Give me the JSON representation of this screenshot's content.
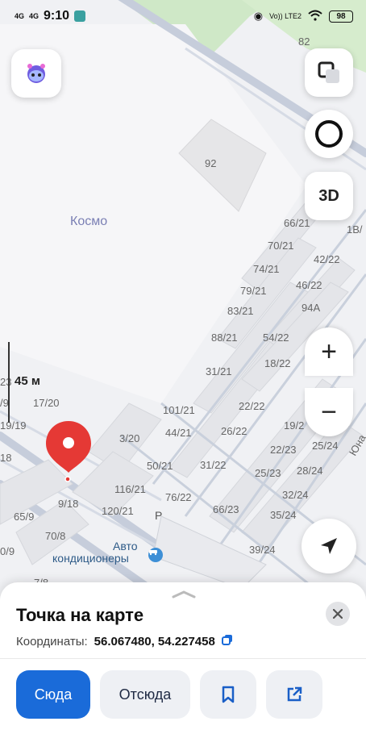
{
  "status_bar": {
    "signal1": "4G",
    "signal2": "4G",
    "time": "9:10",
    "volte": "Vo)) LTE2",
    "battery": "98"
  },
  "map": {
    "place_name": "Космо",
    "scale_label": "45 м",
    "poi_name_line1": "Авто",
    "poi_name_line2": "кондиционеры",
    "street_label": "Юна",
    "parking_label": "P",
    "house_numbers": [
      "82",
      "92",
      "1В/",
      "66/21",
      "70/21",
      "42/22",
      "74/21",
      "46/22",
      "79/21",
      "94А",
      "83/21",
      "88/21",
      "54/22",
      "18/22",
      "31/21",
      "22/22",
      "101/21",
      "26/22",
      "44/21",
      "19/2",
      "17/20",
      "3/20",
      "22/23",
      "25/24",
      "50/21",
      "31/22",
      "25/23",
      "28/24",
      "116/21",
      "32/24",
      "76/22",
      "9/18",
      "120/21",
      "66/23",
      "35/24",
      "65/9",
      "70/8",
      "39/24",
      "0/9",
      "7/8",
      "19/19",
      "23",
      "18",
      "/9"
    ]
  },
  "controls": {
    "button_3d": "3D",
    "zoom_in": "+",
    "zoom_out": "−"
  },
  "sheet": {
    "title": "Точка на карте",
    "coords_label": "Координаты:",
    "coords_value": "56.067480, 54.227458",
    "btn_here": "Сюда",
    "btn_from": "Отсюда"
  },
  "colors": {
    "accent": "#1a6bd9",
    "pin": "#e53935"
  }
}
